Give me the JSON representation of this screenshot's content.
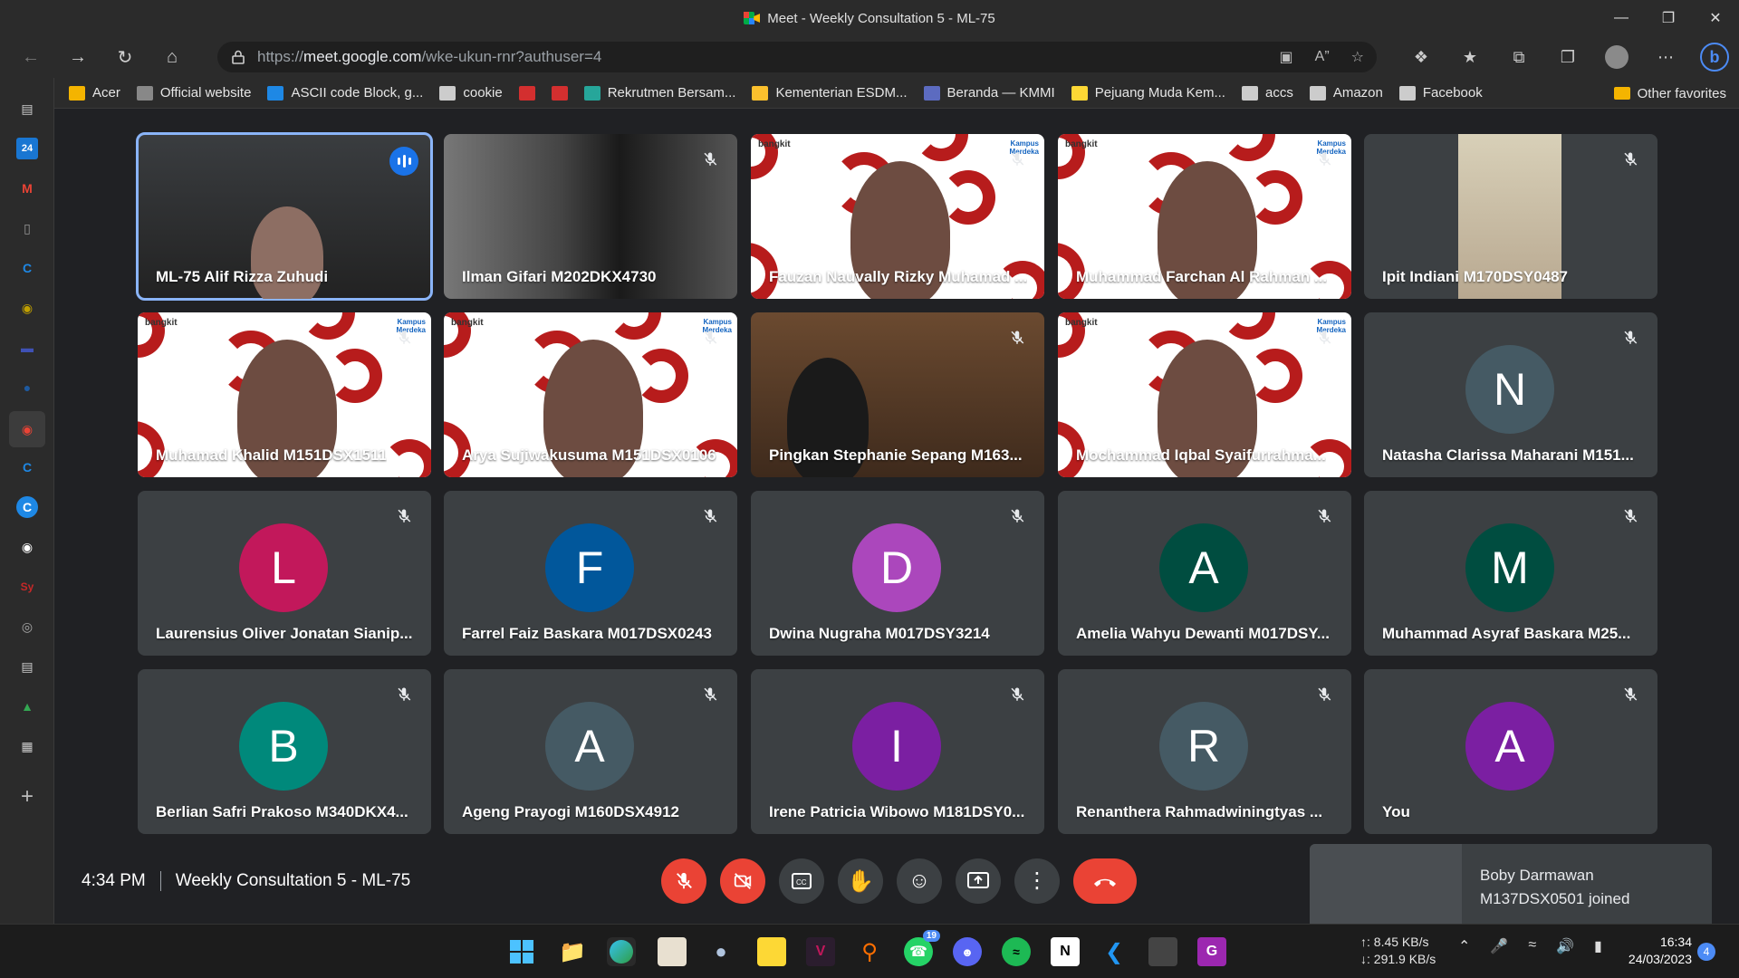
{
  "window": {
    "title": "Meet - Weekly Consultation 5 - ML-75"
  },
  "address": {
    "prefix": "https://",
    "domain": "meet.google.com",
    "path": "/wke-ukun-rnr?authuser=4"
  },
  "bookmarks": [
    {
      "label": "Acer",
      "color": "#f4b400"
    },
    {
      "label": "Official website",
      "color": "#888888"
    },
    {
      "label": "ASCII code Block, g...",
      "color": "#1e88e5"
    },
    {
      "label": "cookie",
      "color": "#cccccc"
    },
    {
      "label": "",
      "color": "#d32f2f"
    },
    {
      "label": "",
      "color": "#d32f2f"
    },
    {
      "label": "Rekrutmen Bersam...",
      "color": "#26a69a"
    },
    {
      "label": "Kementerian ESDM...",
      "color": "#fbc02d"
    },
    {
      "label": "Beranda — KMMI",
      "color": "#5c6bc0"
    },
    {
      "label": "Pejuang Muda Kem...",
      "color": "#fdd835"
    },
    {
      "label": "accs",
      "color": "#cccccc"
    },
    {
      "label": "Amazon",
      "color": "#cccccc"
    },
    {
      "label": "Facebook",
      "color": "#cccccc"
    }
  ],
  "other_favorites": "Other favorites",
  "participants": [
    {
      "name": "ML-75 Alif Rizza Zuhudi",
      "type": "video",
      "bg": "map",
      "speaking": true
    },
    {
      "name": "Ilman Gifari M202DKX4730",
      "type": "video",
      "bg": "dark"
    },
    {
      "name": "Fauzan Nauvally Rizky Muhamad ...",
      "type": "video",
      "bg": "bangkit"
    },
    {
      "name": "Muhammad Farchan Al Rahman ...",
      "type": "video",
      "bg": "bangkit"
    },
    {
      "name": "Ipit Indiani M170DSY0487",
      "type": "video",
      "bg": "portrait"
    },
    {
      "name": "Muhamad Khalid M151DSX1511",
      "type": "video",
      "bg": "bangkit"
    },
    {
      "name": "Arya Sujiwakusuma M151DSX0106",
      "type": "video",
      "bg": "bangkit"
    },
    {
      "name": "Pingkan Stephanie Sepang M163...",
      "type": "video",
      "bg": "room"
    },
    {
      "name": "Mochammad Iqbal Syaifurrahma...",
      "type": "video",
      "bg": "bangkit"
    },
    {
      "name": "Natasha Clarissa Maharani M151...",
      "type": "avatar",
      "initial": "N",
      "color": "#455a64"
    },
    {
      "name": "Laurensius Oliver Jonatan Sianip...",
      "type": "avatar",
      "initial": "L",
      "color": "#c2185b"
    },
    {
      "name": "Farrel Faiz Baskara M017DSX0243",
      "type": "avatar",
      "initial": "F",
      "color": "#01579b"
    },
    {
      "name": "Dwina Nugraha M017DSY3214",
      "type": "avatar",
      "initial": "D",
      "color": "#ab47bc"
    },
    {
      "name": "Amelia Wahyu Dewanti M017DSY...",
      "type": "avatar",
      "initial": "A",
      "color": "#004d40"
    },
    {
      "name": "Muhammad Asyraf Baskara M25...",
      "type": "avatar",
      "initial": "M",
      "color": "#004d40"
    },
    {
      "name": "Berlian Safri Prakoso M340DKX4...",
      "type": "avatar",
      "initial": "B",
      "color": "#00897b"
    },
    {
      "name": "Ageng Prayogi M160DSX4912",
      "type": "avatar",
      "initial": "A",
      "color": "#455a64"
    },
    {
      "name": "Irene Patricia Wibowo M181DSY0...",
      "type": "avatar",
      "initial": "I",
      "color": "#7b1fa2"
    },
    {
      "name": "Renanthera Rahmadwiningtyas ...",
      "type": "avatar",
      "initial": "R",
      "color": "#455a64"
    },
    {
      "name": "You",
      "type": "avatar",
      "initial": "A",
      "color": "#7b1fa2"
    }
  ],
  "meeting": {
    "time": "4:34 PM",
    "title": "Weekly Consultation 5 - ML-75"
  },
  "toast": {
    "line1": "Boby Darmawan",
    "line2": "M137DSX0501 joined"
  },
  "taskbar": {
    "net_up": "↑: 8.45 KB/s",
    "net_down": "↓: 291.9 KB/s",
    "time": "16:34",
    "date": "24/03/2023",
    "whatsapp_badge": "19",
    "notifications": "4"
  }
}
